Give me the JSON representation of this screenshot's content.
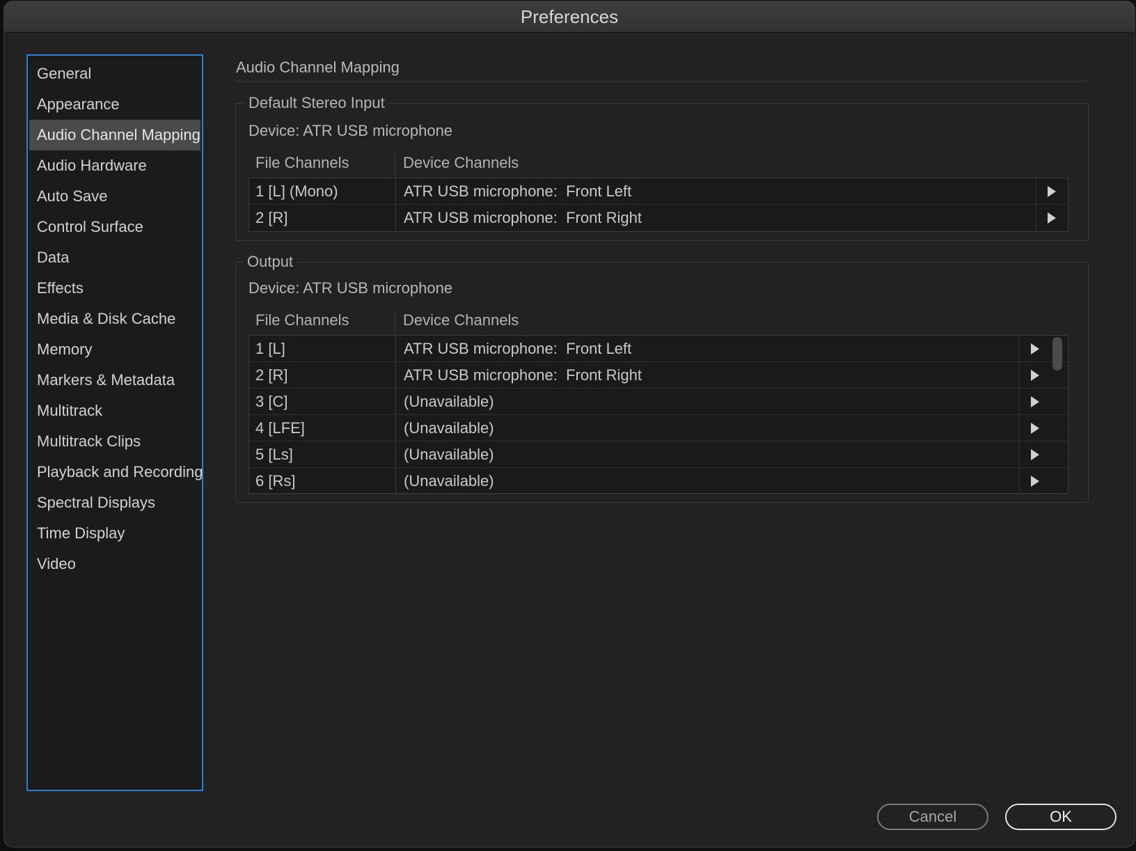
{
  "window": {
    "title": "Preferences"
  },
  "sidebar": {
    "items": [
      {
        "label": "General"
      },
      {
        "label": "Appearance"
      },
      {
        "label": "Audio Channel Mapping",
        "selected": true
      },
      {
        "label": "Audio Hardware"
      },
      {
        "label": "Auto Save"
      },
      {
        "label": "Control Surface"
      },
      {
        "label": "Data"
      },
      {
        "label": "Effects"
      },
      {
        "label": "Media & Disk Cache"
      },
      {
        "label": "Memory"
      },
      {
        "label": "Markers & Metadata"
      },
      {
        "label": "Multitrack"
      },
      {
        "label": "Multitrack Clips"
      },
      {
        "label": "Playback and Recording"
      },
      {
        "label": "Spectral Displays"
      },
      {
        "label": "Time Display"
      },
      {
        "label": "Video"
      }
    ]
  },
  "main": {
    "title": "Audio Channel Mapping",
    "input": {
      "legend": "Default Stereo Input",
      "device": "Device: ATR USB microphone",
      "columns": {
        "file": "File Channels",
        "device": "Device Channels"
      },
      "rows": [
        {
          "file": "1 [L] (Mono)",
          "device": "ATR USB microphone:  Front Left"
        },
        {
          "file": "2 [R]",
          "device": "ATR USB microphone:  Front Right"
        }
      ]
    },
    "output": {
      "legend": "Output",
      "device": "Device: ATR USB microphone",
      "columns": {
        "file": "File Channels",
        "device": "Device Channels"
      },
      "rows": [
        {
          "file": "1 [L]",
          "device": "ATR USB microphone:  Front Left"
        },
        {
          "file": "2 [R]",
          "device": "ATR USB microphone:  Front Right"
        },
        {
          "file": "3 [C]",
          "device": "(Unavailable)"
        },
        {
          "file": "4 [LFE]",
          "device": "(Unavailable)"
        },
        {
          "file": "5 [Ls]",
          "device": "(Unavailable)"
        },
        {
          "file": "6 [Rs]",
          "device": "(Unavailable)"
        }
      ]
    }
  },
  "buttons": {
    "cancel": "Cancel",
    "ok": "OK"
  },
  "colors": {
    "selection_border": "#2f7fd6",
    "selected_item_bg": "#4a4a4a",
    "background": "#222222"
  },
  "icons": {
    "row_expand": "triangle-right-icon"
  }
}
